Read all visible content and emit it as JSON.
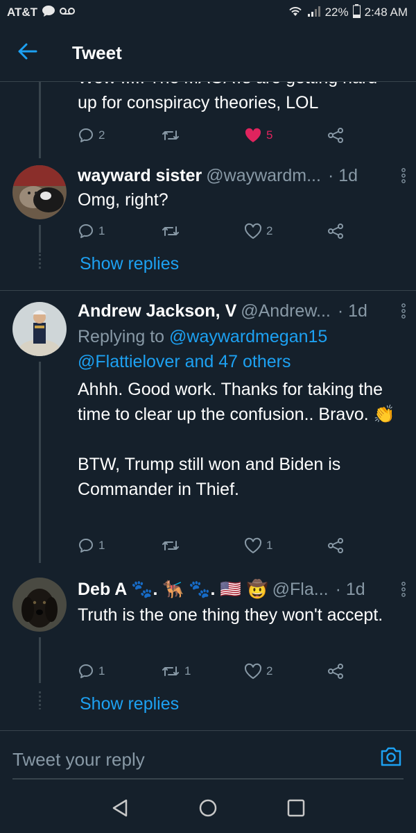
{
  "status_bar": {
    "carrier": "AT&T",
    "battery": "22%",
    "time": "2:48 AM"
  },
  "header": {
    "title": "Tweet"
  },
  "clipped_tweet": {
    "text_top_partial": "Wow ..... The MAGATs are getting hard",
    "text": "up for conspiracy theories, LOL",
    "replies": "2",
    "retweets": "",
    "likes": "5",
    "liked": true
  },
  "tweets": [
    {
      "name": "wayward sister",
      "handle": "@waywardm...",
      "time": "· 1d",
      "body": "Omg, right?",
      "replies": "1",
      "retweets": "",
      "likes": "2",
      "show_replies": "Show replies"
    },
    {
      "name": "Andrew Jackson, V",
      "handle": "@Andrew...",
      "time": "· 1d",
      "replying_prefix": "Replying to ",
      "replying_user": "@waywardmegan15",
      "replying_others": "@Flattielover and 47 others",
      "body": "Ahhh. Good work. Thanks for taking the time to clear up the confusion.. Bravo. 👏\n\nBTW, Trump still won and Biden is Commander in Thief.",
      "replies": "1",
      "retweets": "",
      "likes": "1"
    },
    {
      "name": "Deb A 🐾. 🐕‍🦺 🐾. 🇺🇸 🤠",
      "handle": "@Fla...",
      "time": "· 1d",
      "body": "Truth is the one thing they won't accept.",
      "replies": "1",
      "retweets": "1",
      "likes": "2",
      "show_replies": "Show replies"
    }
  ],
  "reply_bar": {
    "placeholder": "Tweet your reply"
  },
  "colors": {
    "background": "#15202b",
    "accent": "#1da1f2",
    "secondary_text": "#8899a6",
    "like": "#e0245e",
    "divider": "#38444d"
  },
  "icons": [
    "back-arrow-icon",
    "reply-icon",
    "retweet-icon",
    "heart-icon",
    "share-icon",
    "more-vertical-icon",
    "camera-icon",
    "nav-back-icon",
    "nav-home-icon",
    "nav-recents-icon"
  ]
}
